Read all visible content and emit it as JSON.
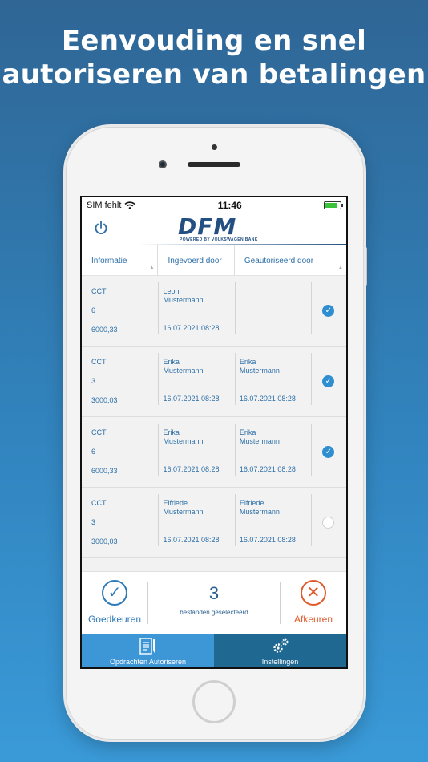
{
  "headline": {
    "line1": "Eenvouding en snel",
    "line2": "autoriseren van betalingen"
  },
  "status_bar": {
    "carrier": "SIM fehlt",
    "time": "11:46",
    "battery_level": 0.8
  },
  "header": {
    "logo_text": "DFM",
    "logo_sub": "POWERED BY VOLKSWAGEN BANK"
  },
  "table": {
    "columns": [
      "Informatie",
      "Ingevoerd door",
      "Geautoriseerd door"
    ],
    "rows": [
      {
        "type": "CCT",
        "count": "6",
        "amount": "6000,33",
        "entered_by": "Leon Mustermann",
        "entered_date": "16.07.2021 08:28",
        "authorized_by": "",
        "authorized_date": "",
        "checked": true
      },
      {
        "type": "CCT",
        "count": "3",
        "amount": "3000,03",
        "entered_by": "Erika Mustermann",
        "entered_date": "16.07.2021 08:28",
        "authorized_by": "Erika Mustermann",
        "authorized_date": "16.07.2021 08:28",
        "checked": true
      },
      {
        "type": "CCT",
        "count": "6",
        "amount": "6000,33",
        "entered_by": "Erika Mustermann",
        "entered_date": "16.07.2021 08:28",
        "authorized_by": "Erika Mustermann",
        "authorized_date": "16.07.2021 08:28",
        "checked": true
      },
      {
        "type": "CCT",
        "count": "3",
        "amount": "3000,03",
        "entered_by": "Elfriede Mustermann",
        "entered_date": "16.07.2021 08:28",
        "authorized_by": "Elfriede Mustermann",
        "authorized_date": "16.07.2021 08:28",
        "checked": false
      }
    ]
  },
  "actions": {
    "approve_label": "Goedkeuren",
    "reject_label": "Afkeuren",
    "selected_count": "3",
    "selected_label": "bestanden geselecteerd"
  },
  "tabs": [
    {
      "label": "Opdrachten Autoriseren",
      "icon": "document-pen-icon",
      "active": true
    },
    {
      "label": "Instellingen",
      "icon": "gears-icon",
      "active": false
    }
  ],
  "colors": {
    "primary": "#2f7ab8",
    "reject": "#e05a2b",
    "check": "#2f8ed0",
    "tab_active": "#3d97d6",
    "tab_inactive": "#1e6892"
  }
}
